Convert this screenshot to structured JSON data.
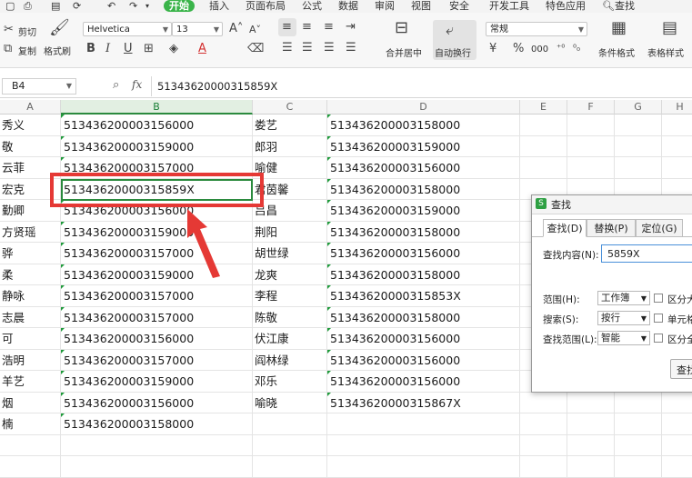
{
  "menu": {
    "items": [
      "开始",
      "插入",
      "页面布局",
      "公式",
      "数据",
      "审阅",
      "视图",
      "安全",
      "开发工具",
      "特色应用",
      "查找"
    ]
  },
  "ribbon": {
    "cut_label": "剪切",
    "copy_label": "复制",
    "format_painter_label": "格式刷",
    "font_name": "Helvetica",
    "font_size": "13",
    "number_format": "常规",
    "merge_center_label": "合并居中",
    "wrap_text_label": "自动换行",
    "conditional_format_label": "条件格式",
    "table_style_label": "表格样式",
    "bold": "B",
    "italic": "I",
    "underline": "U",
    "font_color_glyph": "A",
    "percent": "%",
    "thousands": "000",
    "grow_font": "A",
    "shrink_font": "A"
  },
  "formula_bar": {
    "cell_ref": "B4",
    "fx": "fx",
    "value": "51343620000315859X"
  },
  "columns": [
    "A",
    "B",
    "C",
    "D",
    "E",
    "F",
    "G",
    "H"
  ],
  "rows": [
    {
      "a": "秀义",
      "b": "513436200003156000",
      "c": "娄艺",
      "d": "513436200003158000"
    },
    {
      "a": "敬",
      "b": "513436200003159000",
      "c": "郎羽",
      "d": "513436200003159000"
    },
    {
      "a": "云菲",
      "b": "513436200003157000",
      "c": "喻健",
      "d": "513436200003156000"
    },
    {
      "a": "宏克",
      "b": "51343620000315859X",
      "c": "君茵馨",
      "d": "513436200003158000"
    },
    {
      "a": "勤卿",
      "b": "513436200003156000",
      "c": "吕昌",
      "d": "513436200003159000"
    },
    {
      "a": "方贤瑶",
      "b": "513436200003159000",
      "c": "荆阳",
      "d": "513436200003158000"
    },
    {
      "a": "骅",
      "b": "513436200003157000",
      "c": "胡世绿",
      "d": "513436200003156000"
    },
    {
      "a": "柔",
      "b": "513436200003159000",
      "c": "龙爽",
      "d": "513436200003158000"
    },
    {
      "a": "静咏",
      "b": "513436200003157000",
      "c": "李程",
      "d": "51343620000315853X"
    },
    {
      "a": "志晨",
      "b": "513436200003157000",
      "c": "陈敬",
      "d": "513436200003158000"
    },
    {
      "a": "可",
      "b": "513436200003156000",
      "c": "伏江康",
      "d": "513436200003156000"
    },
    {
      "a": "浩明",
      "b": "513436200003157000",
      "c": "阎林绿",
      "d": "513436200003156000"
    },
    {
      "a": "羊艺",
      "b": "513436200003159000",
      "c": "邓乐",
      "d": "513436200003156000"
    },
    {
      "a": "烟",
      "b": "513436200003156000",
      "c": "喻晓",
      "d": "51343620000315867X"
    },
    {
      "a": "楠",
      "b": "513436200003158000",
      "c": "",
      "d": ""
    }
  ],
  "find_dialog": {
    "title": "查找",
    "tabs": [
      "查找(D)",
      "替换(P)",
      "定位(G)"
    ],
    "find_what_label": "查找内容(N):",
    "find_what_value": "5859X",
    "scope_label": "范围(H):",
    "scope_value": "工作簿",
    "search_label": "搜索(S):",
    "search_value": "按行",
    "look_in_label": "查找范围(L):",
    "look_in_value": "智能",
    "match_case_label": "区分大",
    "match_cell_label": "单元格",
    "match_width_label": "区分全",
    "find_button_label": "查找"
  },
  "colors": {
    "accent_green": "#3ab44a",
    "highlight_red": "#e53935",
    "selection_green": "#2b8a3e"
  }
}
